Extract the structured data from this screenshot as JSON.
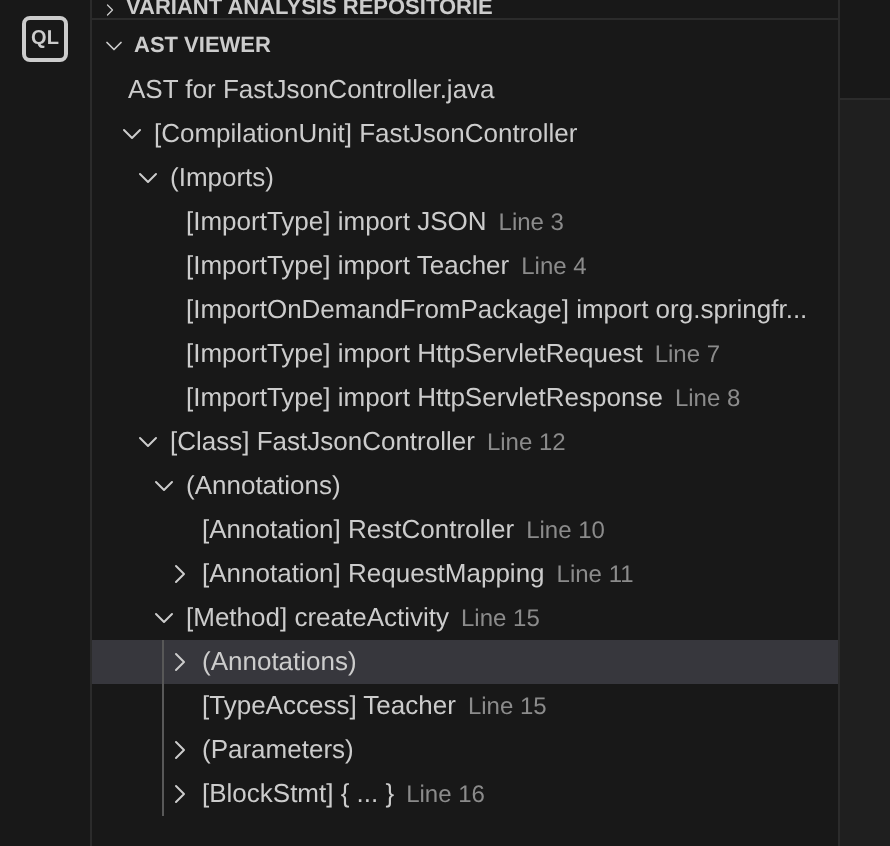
{
  "activity_bar": {
    "logo": "QL"
  },
  "sections": [
    {
      "title": "VARIANT ANALYSIS REPOSITORIE",
      "expanded": false
    },
    {
      "title": "AST VIEWER",
      "expanded": true
    }
  ],
  "ast_viewer": {
    "heading": "AST for FastJsonController.java",
    "tree": [
      {
        "label": "[CompilationUnit] FastJsonController",
        "expanded": true,
        "selected": false,
        "children": [
          {
            "label": "(Imports)",
            "expanded": true,
            "selected": false,
            "children": [
              {
                "label": "[ImportType] import JSON",
                "line": "Line 3",
                "selected": false
              },
              {
                "label": "[ImportType] import Teacher",
                "line": "Line 4",
                "selected": false
              },
              {
                "label": "[ImportOnDemandFromPackage] import org.springfr...",
                "selected": false
              },
              {
                "label": "[ImportType] import HttpServletRequest",
                "line": "Line 7",
                "selected": false
              },
              {
                "label": "[ImportType] import HttpServletResponse",
                "line": "Line 8",
                "selected": false
              }
            ]
          },
          {
            "label": "[Class] FastJsonController",
            "line": "Line 12",
            "expanded": true,
            "selected": false,
            "children": [
              {
                "label": "(Annotations)",
                "expanded": true,
                "selected": false,
                "children": [
                  {
                    "label": "[Annotation] RestController",
                    "line": "Line 10",
                    "selected": false
                  },
                  {
                    "label": "[Annotation] RequestMapping",
                    "line": "Line 11",
                    "expanded": false,
                    "selected": false
                  }
                ]
              },
              {
                "label": "[Method] createActivity",
                "line": "Line 15",
                "expanded": true,
                "selected": false,
                "children": [
                  {
                    "label": "(Annotations)",
                    "expanded": false,
                    "selected": true
                  },
                  {
                    "label": "[TypeAccess] Teacher",
                    "line": "Line 15",
                    "selected": false
                  },
                  {
                    "label": "(Parameters)",
                    "expanded": false,
                    "selected": false
                  },
                  {
                    "label": "[BlockStmt] { ... }",
                    "line": "Line 16",
                    "expanded": false,
                    "selected": false
                  }
                ]
              }
            ]
          }
        ]
      }
    ]
  }
}
